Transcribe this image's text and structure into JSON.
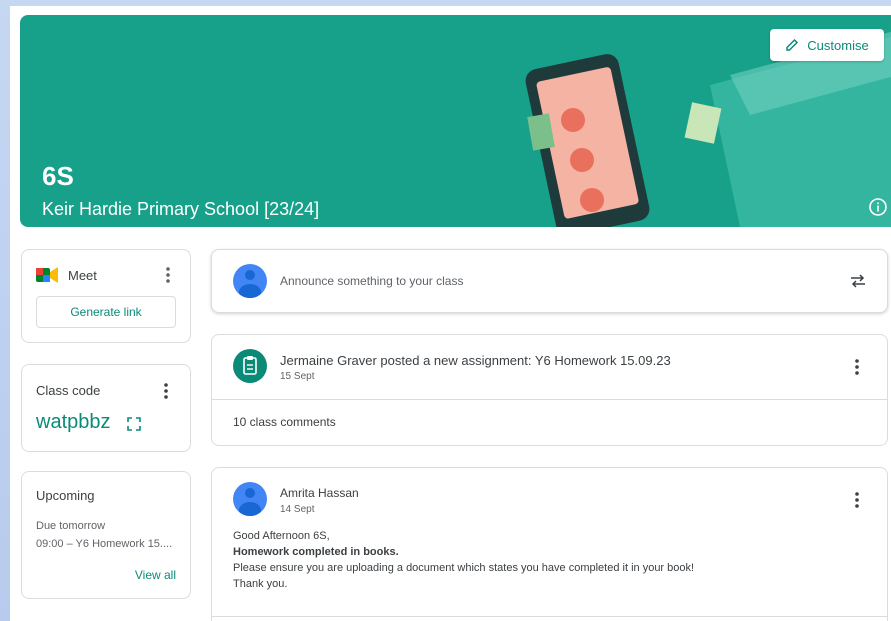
{
  "banner": {
    "title": "6S",
    "subtitle": "Keir Hardie Primary School [23/24]",
    "customise_label": "Customise",
    "color": "#17a08a"
  },
  "meet": {
    "label": "Meet",
    "generate_link": "Generate link"
  },
  "class_code": {
    "label": "Class code",
    "value": "watpbbz"
  },
  "upcoming": {
    "title": "Upcoming",
    "due": "Due tomorrow",
    "item": "09:00 – Y6 Homework 15....",
    "view_all": "View all"
  },
  "announce": {
    "placeholder": "Announce something to your class"
  },
  "assignment": {
    "title": "Jermaine Graver posted a new assignment: Y6 Homework 15.09.23",
    "date": "15 Sept",
    "comments": "10 class comments"
  },
  "post": {
    "author": "Amrita Hassan",
    "date": "14 Sept",
    "line1": "Good Afternoon 6S,",
    "line2": "Homework completed in books.",
    "line3": "Please ensure you are uploading a document which states you have completed it in your book!",
    "line4": "Thank you."
  },
  "colors": {
    "accent": "#0b8a78",
    "avatar": "#4285f4"
  }
}
